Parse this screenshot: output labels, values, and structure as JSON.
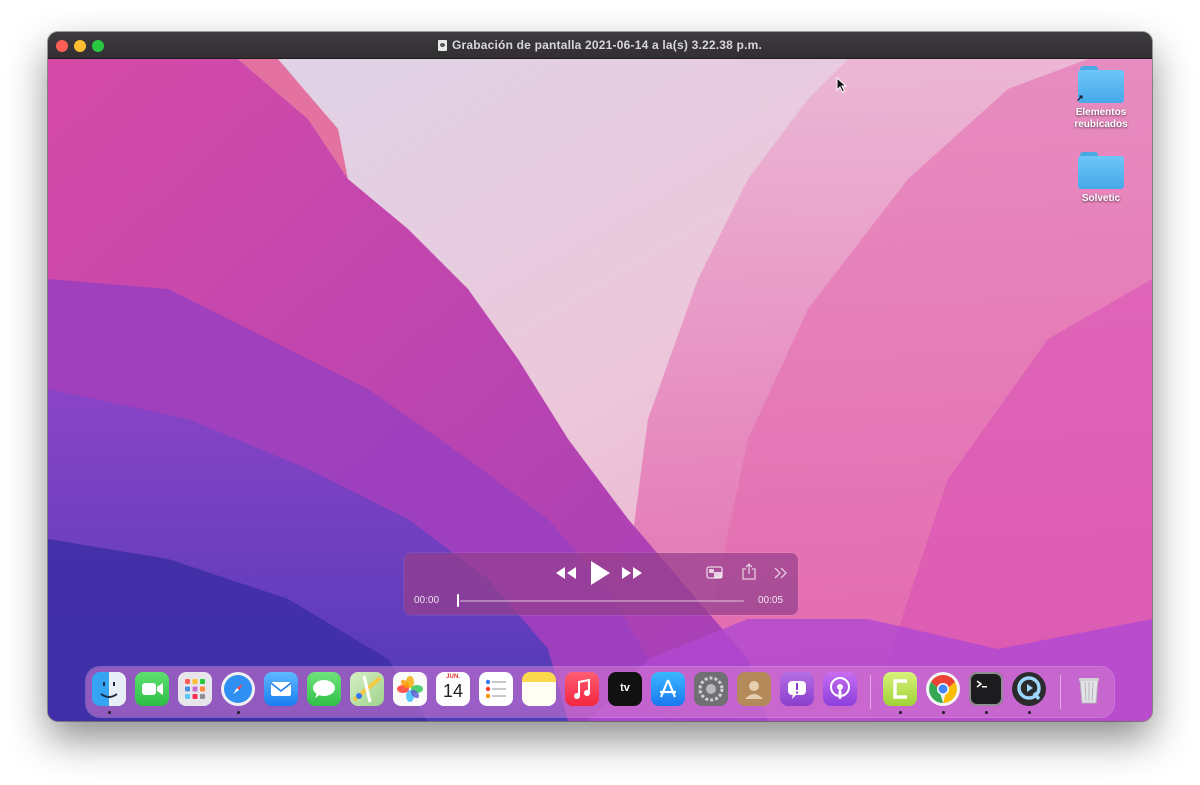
{
  "window": {
    "title": "Grabación de pantalla 2021-06-14 a la(s) 3.22.38 p.m."
  },
  "desktop_icons": [
    {
      "label_line1": "Elementos",
      "label_line2": "reubicados",
      "icon": "folder-alias-icon"
    },
    {
      "label_line1": "Solvetic",
      "label_line2": "",
      "icon": "folder-icon"
    }
  ],
  "player": {
    "current_time": "00:00",
    "duration": "00:05",
    "progress": 0.0
  },
  "dock": {
    "calendar_month": "JUN.",
    "calendar_day": "14",
    "tv_label": "tv",
    "apps": [
      "Finder",
      "FaceTime",
      "Launchpad",
      "Safari",
      "Mail",
      "Messages",
      "Maps",
      "Photos",
      "Calendar",
      "Reminders",
      "Notes",
      "Music",
      "TV",
      "App Store",
      "System Preferences",
      "Contacts",
      "Feedback Assistant",
      "Podcasts",
      "Camtasia",
      "Chrome",
      "Terminal",
      "QuickTime Player",
      "Trash"
    ]
  },
  "colors": {
    "close": "#ff5f57",
    "minimize": "#febc2e",
    "maximize": "#28c840",
    "wallpaper_magenta": "#c8488f",
    "wallpaper_violet": "#5a3fc4"
  }
}
